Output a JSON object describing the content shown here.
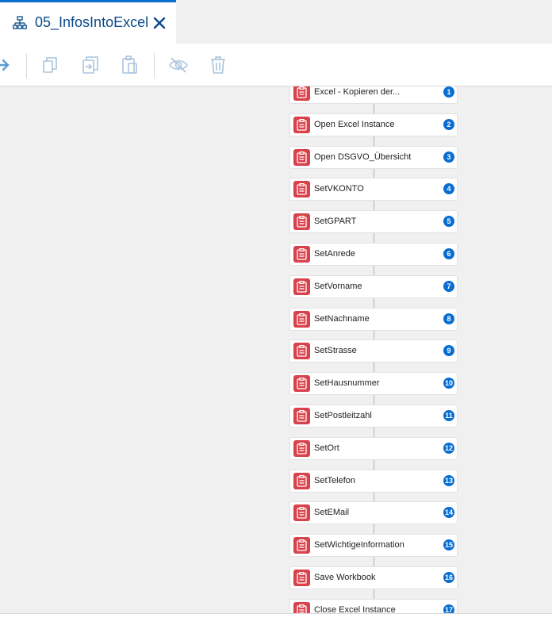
{
  "tab": {
    "title": "05_InfosIntoExcel",
    "icon": "workflow-icon",
    "close_icon": "close-icon"
  },
  "toolbar": {
    "buttons": [
      {
        "name": "forward-arrow-icon",
        "enabled": true
      },
      {
        "name": "copy-icon",
        "enabled": false
      },
      {
        "name": "export-icon",
        "enabled": false
      },
      {
        "name": "paste-icon",
        "enabled": false
      },
      {
        "name": "hide-icon",
        "enabled": false
      },
      {
        "name": "delete-icon",
        "enabled": false
      }
    ]
  },
  "steps": [
    {
      "label": "Excel - Kopieren der...",
      "num": "1"
    },
    {
      "label": "Open Excel Instance",
      "num": "2"
    },
    {
      "label": "Open DSGVO_Übersicht",
      "num": "3"
    },
    {
      "label": "SetVKONTO",
      "num": "4"
    },
    {
      "label": "SetGPART",
      "num": "5"
    },
    {
      "label": "SetAnrede",
      "num": "6"
    },
    {
      "label": "SetVorname",
      "num": "7"
    },
    {
      "label": "SetNachname",
      "num": "8"
    },
    {
      "label": "SetStrasse",
      "num": "9"
    },
    {
      "label": "SetHausnummer",
      "num": "10"
    },
    {
      "label": "SetPostleitzahl",
      "num": "11"
    },
    {
      "label": "SetOrt",
      "num": "12"
    },
    {
      "label": "SetTelefon",
      "num": "13"
    },
    {
      "label": "SetEMail",
      "num": "14"
    },
    {
      "label": "SetWichtigeInformation",
      "num": "15"
    },
    {
      "label": "Save Workbook",
      "num": "16"
    },
    {
      "label": "Close Excel Instance",
      "num": "17"
    }
  ],
  "colors": {
    "accent": "#0a6ed1",
    "step_icon": "#d9414b",
    "disabled_icon": "#a9c3dc"
  }
}
